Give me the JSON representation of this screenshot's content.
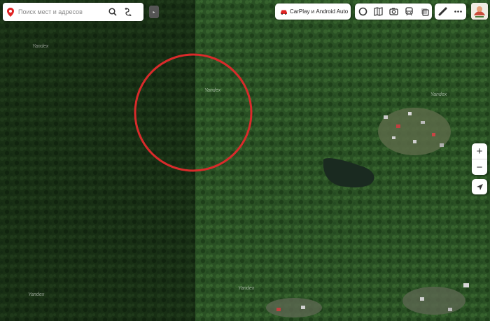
{
  "search": {
    "placeholder": "Поиск мест и адресов"
  },
  "carplay": {
    "label": "CarPlay и Android Auto"
  },
  "watermarks": [
    "Yandex",
    "Yandex",
    "Yandex",
    "Yandex",
    "Yandex"
  ],
  "zoom": {
    "in_label": "+",
    "out_label": "−"
  },
  "colors": {
    "accent_red": "#e02424",
    "forest_dark": "#1d3a1a",
    "forest_light": "#2e5a26",
    "lake": "#1a2a20",
    "overlay_circle": "#d92b2b"
  },
  "icons": [
    "map-pin-icon",
    "search-icon",
    "route-icon",
    "collapse-arrow-icon",
    "car-icon",
    "layers-icon",
    "panorama-icon",
    "camera-icon",
    "transit-icon",
    "traffic-icon",
    "ruler-icon",
    "more-icon",
    "avatar-icon",
    "zoom-in-icon",
    "zoom-out-icon",
    "locate-icon"
  ]
}
